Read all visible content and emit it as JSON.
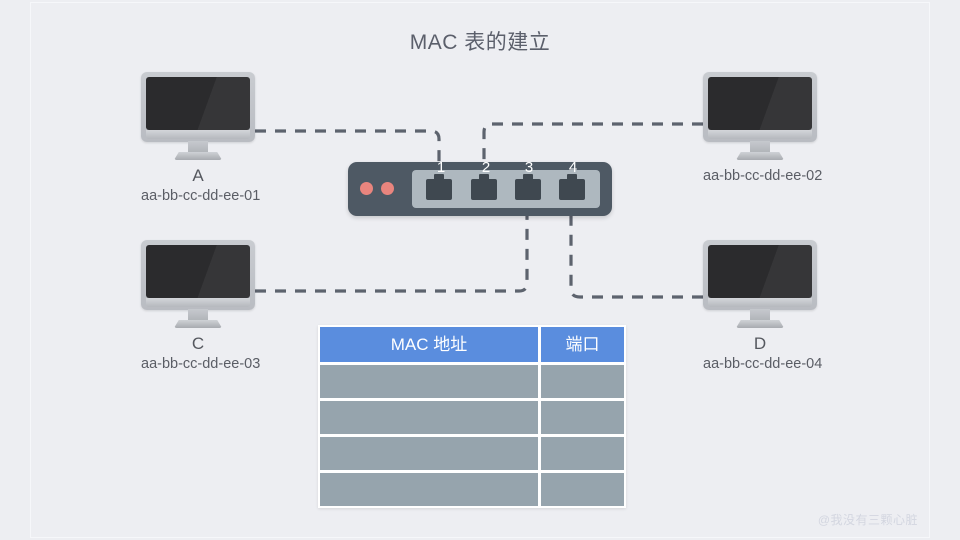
{
  "slide": {
    "title": "MAC 表的建立",
    "watermark": "@我没有三颗心脏",
    "background_color": "#edeef2",
    "title_color": "#5b5f6b"
  },
  "computers": [
    {
      "id": "A",
      "letter": "A",
      "mac": "aa-bb-cc-dd-ee-01",
      "position": "top-left",
      "connected_port": "1"
    },
    {
      "id": "B",
      "letter": "",
      "mac": "aa-bb-cc-dd-ee-02",
      "position": "top-right",
      "connected_port": "2"
    },
    {
      "id": "C",
      "letter": "C",
      "mac": "aa-bb-cc-dd-ee-03",
      "position": "bottom-left",
      "connected_port": "3"
    },
    {
      "id": "D",
      "letter": "D",
      "mac": "aa-bb-cc-dd-ee-04",
      "position": "bottom-right",
      "connected_port": "4"
    }
  ],
  "switch": {
    "body_color": "#4e5964",
    "port_bay_color": "#aeb8bf",
    "led_color": "#e9857e",
    "leds": 2,
    "ports": [
      {
        "number": "1"
      },
      {
        "number": "2"
      },
      {
        "number": "3"
      },
      {
        "number": "4"
      }
    ]
  },
  "links": {
    "style": "dashed",
    "color": "#5d636e",
    "items": [
      {
        "from": "A",
        "to_port": "1"
      },
      {
        "from": "B",
        "to_port": "2"
      },
      {
        "from": "C",
        "to_port": "3"
      },
      {
        "from": "D",
        "to_port": "4"
      }
    ]
  },
  "mac_table": {
    "header_color": "#5a8dde",
    "cell_color": "#96a4ad",
    "headers": {
      "mac": "MAC 地址",
      "port": "端口"
    },
    "rows": [
      {
        "mac": "",
        "port": ""
      },
      {
        "mac": "",
        "port": ""
      },
      {
        "mac": "",
        "port": ""
      },
      {
        "mac": "",
        "port": ""
      }
    ]
  }
}
